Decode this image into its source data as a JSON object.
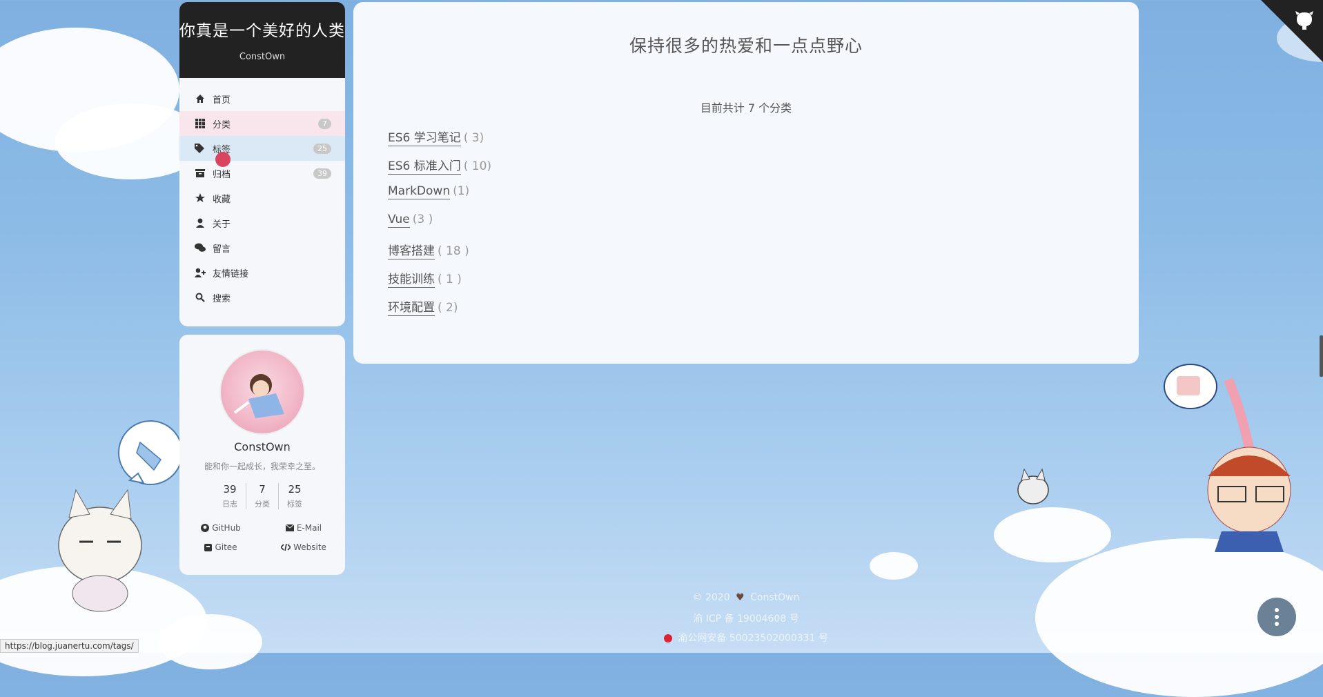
{
  "site": {
    "title": "你真是一个美好的人类",
    "subtitle": "ConstOwn"
  },
  "menu": [
    {
      "label": "首页",
      "icon": "home-icon"
    },
    {
      "label": "分类",
      "icon": "grid-icon",
      "badge": "7"
    },
    {
      "label": "标签",
      "icon": "tags-icon",
      "badge": "25"
    },
    {
      "label": "归档",
      "icon": "archive-icon",
      "badge": "39"
    },
    {
      "label": "收藏",
      "icon": "star-icon"
    },
    {
      "label": "关于",
      "icon": "user-icon"
    },
    {
      "label": "留言",
      "icon": "comments-icon"
    },
    {
      "label": "友情链接",
      "icon": "user-plus-icon"
    },
    {
      "label": "搜索",
      "icon": "search-icon"
    }
  ],
  "profile": {
    "name": "ConstOwn",
    "motto": "能和你一起成长，我荣幸之至。",
    "stats": [
      {
        "num": "39",
        "label": "日志"
      },
      {
        "num": "7",
        "label": "分类"
      },
      {
        "num": "25",
        "label": "标签"
      }
    ],
    "links": [
      {
        "label": "GitHub",
        "icon": "github-icon"
      },
      {
        "label": "E-Mail",
        "icon": "envelope-icon"
      },
      {
        "label": "Gitee",
        "icon": "gitee-icon"
      },
      {
        "label": "Website",
        "icon": "code-icon"
      }
    ]
  },
  "main": {
    "slogan": "保持很多的热爱和一点点野心",
    "count_text": "目前共计 7 个分类",
    "categories": [
      {
        "name": "ES6 学习笔记",
        "count": "( 3)"
      },
      {
        "name": "ES6 标准入门",
        "count": "( 10)"
      },
      {
        "name": "MarkDown",
        "count": "(1)"
      },
      {
        "name": "Vue",
        "count": "(3 )"
      },
      {
        "name": "博客搭建",
        "count": "( 18 )"
      },
      {
        "name": "技能训练",
        "count": "( 1 )"
      },
      {
        "name": "环境配置",
        "count": "( 2)"
      }
    ]
  },
  "footer": {
    "copyright": "© 2020",
    "author": "ConstOwn",
    "icp": "渝 ICP 备 19004608 号",
    "police": "渝公网安备 50023502000331 号"
  },
  "statusbar": "https://blog.juanertu.com/tags/",
  "colors": {
    "brand_bg": "#222222",
    "active": "#f8e6ec",
    "hover": "#dbe8f6",
    "fab": "#6a8196"
  }
}
